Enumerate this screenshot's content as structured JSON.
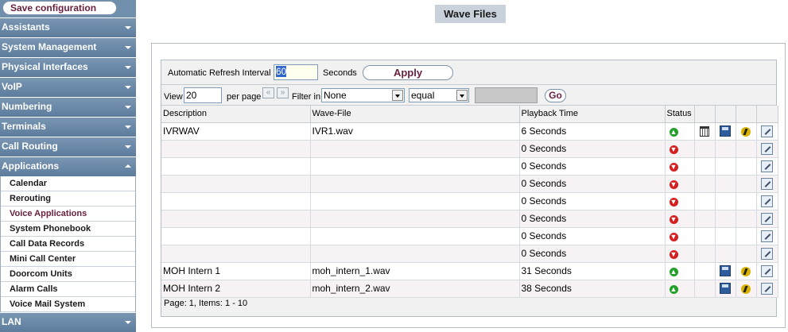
{
  "sidebar": {
    "save_label": "Save configuration",
    "menus": [
      {
        "label": "Assistants",
        "open": false
      },
      {
        "label": "System Management",
        "open": false
      },
      {
        "label": "Physical Interfaces",
        "open": false
      },
      {
        "label": "VoIP",
        "open": false
      },
      {
        "label": "Numbering",
        "open": false
      },
      {
        "label": "Terminals",
        "open": false
      },
      {
        "label": "Call Routing",
        "open": false
      },
      {
        "label": "Applications",
        "open": true
      },
      {
        "label": "LAN",
        "open": false
      }
    ],
    "applications_items": [
      "Calendar",
      "Rerouting",
      "Voice Applications",
      "System Phonebook",
      "Call Data Records",
      "Mini Call Center",
      "Doorcom Units",
      "Alarm Calls",
      "Voice Mail System"
    ],
    "active_item": "Voice Applications"
  },
  "header": {
    "title": "Wave Files"
  },
  "refresh": {
    "label": "Automatic Refresh Interval",
    "value": "60",
    "unit": "Seconds",
    "apply_label": "Apply"
  },
  "filter": {
    "view_label": "View",
    "view_value": "20",
    "per_page_label": "per page",
    "prev_glyph": "«",
    "next_glyph": "»",
    "filter_in_label": "Filter in",
    "field_value": "None",
    "operator_value": "equal",
    "go_label": "Go"
  },
  "table": {
    "headers": {
      "description": "Description",
      "wave_file": "Wave-File",
      "playback_time": "Playback Time",
      "status": "Status"
    },
    "rows": [
      {
        "description": "IVRWAV",
        "wave_file": "IVR1.wav",
        "playback": "6 Seconds",
        "status": "ok",
        "delete": true,
        "save": true,
        "play": true,
        "edit": true
      },
      {
        "description": "",
        "wave_file": "",
        "playback": "0 Seconds",
        "status": "error",
        "delete": false,
        "save": false,
        "play": false,
        "edit": true
      },
      {
        "description": "",
        "wave_file": "",
        "playback": "0 Seconds",
        "status": "error",
        "delete": false,
        "save": false,
        "play": false,
        "edit": true
      },
      {
        "description": "",
        "wave_file": "",
        "playback": "0 Seconds",
        "status": "error",
        "delete": false,
        "save": false,
        "play": false,
        "edit": true
      },
      {
        "description": "",
        "wave_file": "",
        "playback": "0 Seconds",
        "status": "error",
        "delete": false,
        "save": false,
        "play": false,
        "edit": true
      },
      {
        "description": "",
        "wave_file": "",
        "playback": "0 Seconds",
        "status": "error",
        "delete": false,
        "save": false,
        "play": false,
        "edit": true
      },
      {
        "description": "",
        "wave_file": "",
        "playback": "0 Seconds",
        "status": "error",
        "delete": false,
        "save": false,
        "play": false,
        "edit": true
      },
      {
        "description": "",
        "wave_file": "",
        "playback": "0 Seconds",
        "status": "error",
        "delete": false,
        "save": false,
        "play": false,
        "edit": true
      },
      {
        "description": "MOH Intern 1",
        "wave_file": "moh_intern_1.wav",
        "playback": "31 Seconds",
        "status": "ok",
        "delete": false,
        "save": true,
        "play": true,
        "edit": true
      },
      {
        "description": "MOH Intern 2",
        "wave_file": "moh_intern_2.wav",
        "playback": "38 Seconds",
        "status": "ok",
        "delete": false,
        "save": true,
        "play": true,
        "edit": true
      }
    ],
    "footer": "Page: 1, Items:  1 - 10"
  },
  "colors": {
    "menu_bg": "#6f8fad",
    "accent_text": "#6a2040",
    "status_ok": "#22a02a",
    "status_error": "#d42020"
  }
}
